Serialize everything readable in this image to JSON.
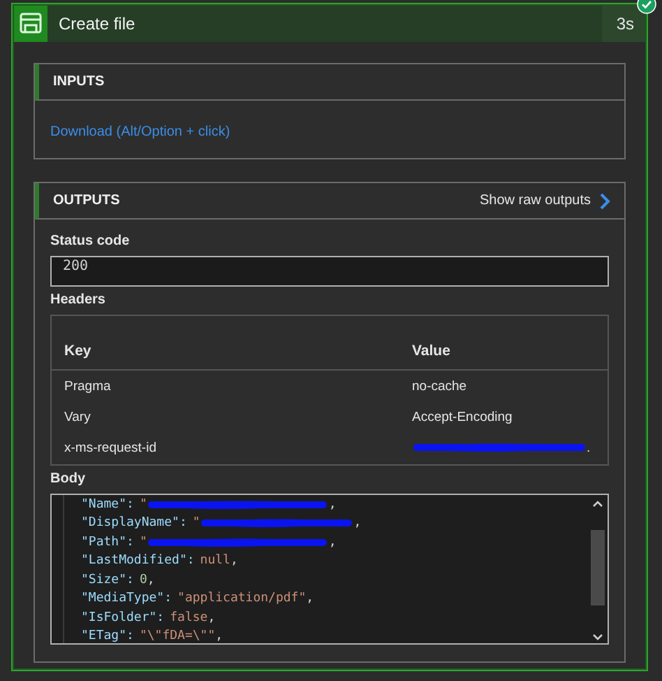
{
  "action": {
    "title": "Create file",
    "duration": "3s",
    "succeeded": true
  },
  "inputs": {
    "title": "INPUTS",
    "link": "Download (Alt/Option + click)"
  },
  "outputs": {
    "title": "OUTPUTS",
    "raw_link": "Show raw outputs",
    "status_label": "Status code",
    "status_value": "200",
    "headers_label": "Headers",
    "headers_columns": [
      "Key",
      "Value"
    ],
    "headers_rows": [
      {
        "key": "Pragma",
        "value": "no-cache",
        "redacted": false
      },
      {
        "key": "Vary",
        "value": "Accept-Encoding",
        "redacted": false
      },
      {
        "key": "x-ms-request-id",
        "value": ".",
        "redacted": true
      }
    ],
    "body_label": "Body",
    "body_lines": [
      {
        "key": "\"Name\":",
        "value": "\"",
        "kind": "string",
        "redacted": true,
        "tail": ","
      },
      {
        "key": "\"DisplayName\":",
        "value": "\"",
        "kind": "string",
        "redacted": true,
        "tail": ","
      },
      {
        "key": "\"Path\":",
        "value": "\"",
        "kind": "string",
        "redacted": true,
        "tail": ","
      },
      {
        "key": "\"LastModified\":",
        "value": "null",
        "kind": "keyword",
        "redacted": false,
        "tail": ","
      },
      {
        "key": "\"Size\":",
        "value": "0",
        "kind": "number",
        "redacted": false,
        "tail": ","
      },
      {
        "key": "\"MediaType\":",
        "value": "\"application/pdf\"",
        "kind": "string",
        "redacted": false,
        "tail": ","
      },
      {
        "key": "\"IsFolder\":",
        "value": "false",
        "kind": "keyword",
        "redacted": false,
        "tail": ","
      },
      {
        "key": "\"ETag\":",
        "value": "\"\\\"fDA=\\\"\"",
        "kind": "string",
        "redacted": false,
        "tail": ","
      }
    ]
  }
}
